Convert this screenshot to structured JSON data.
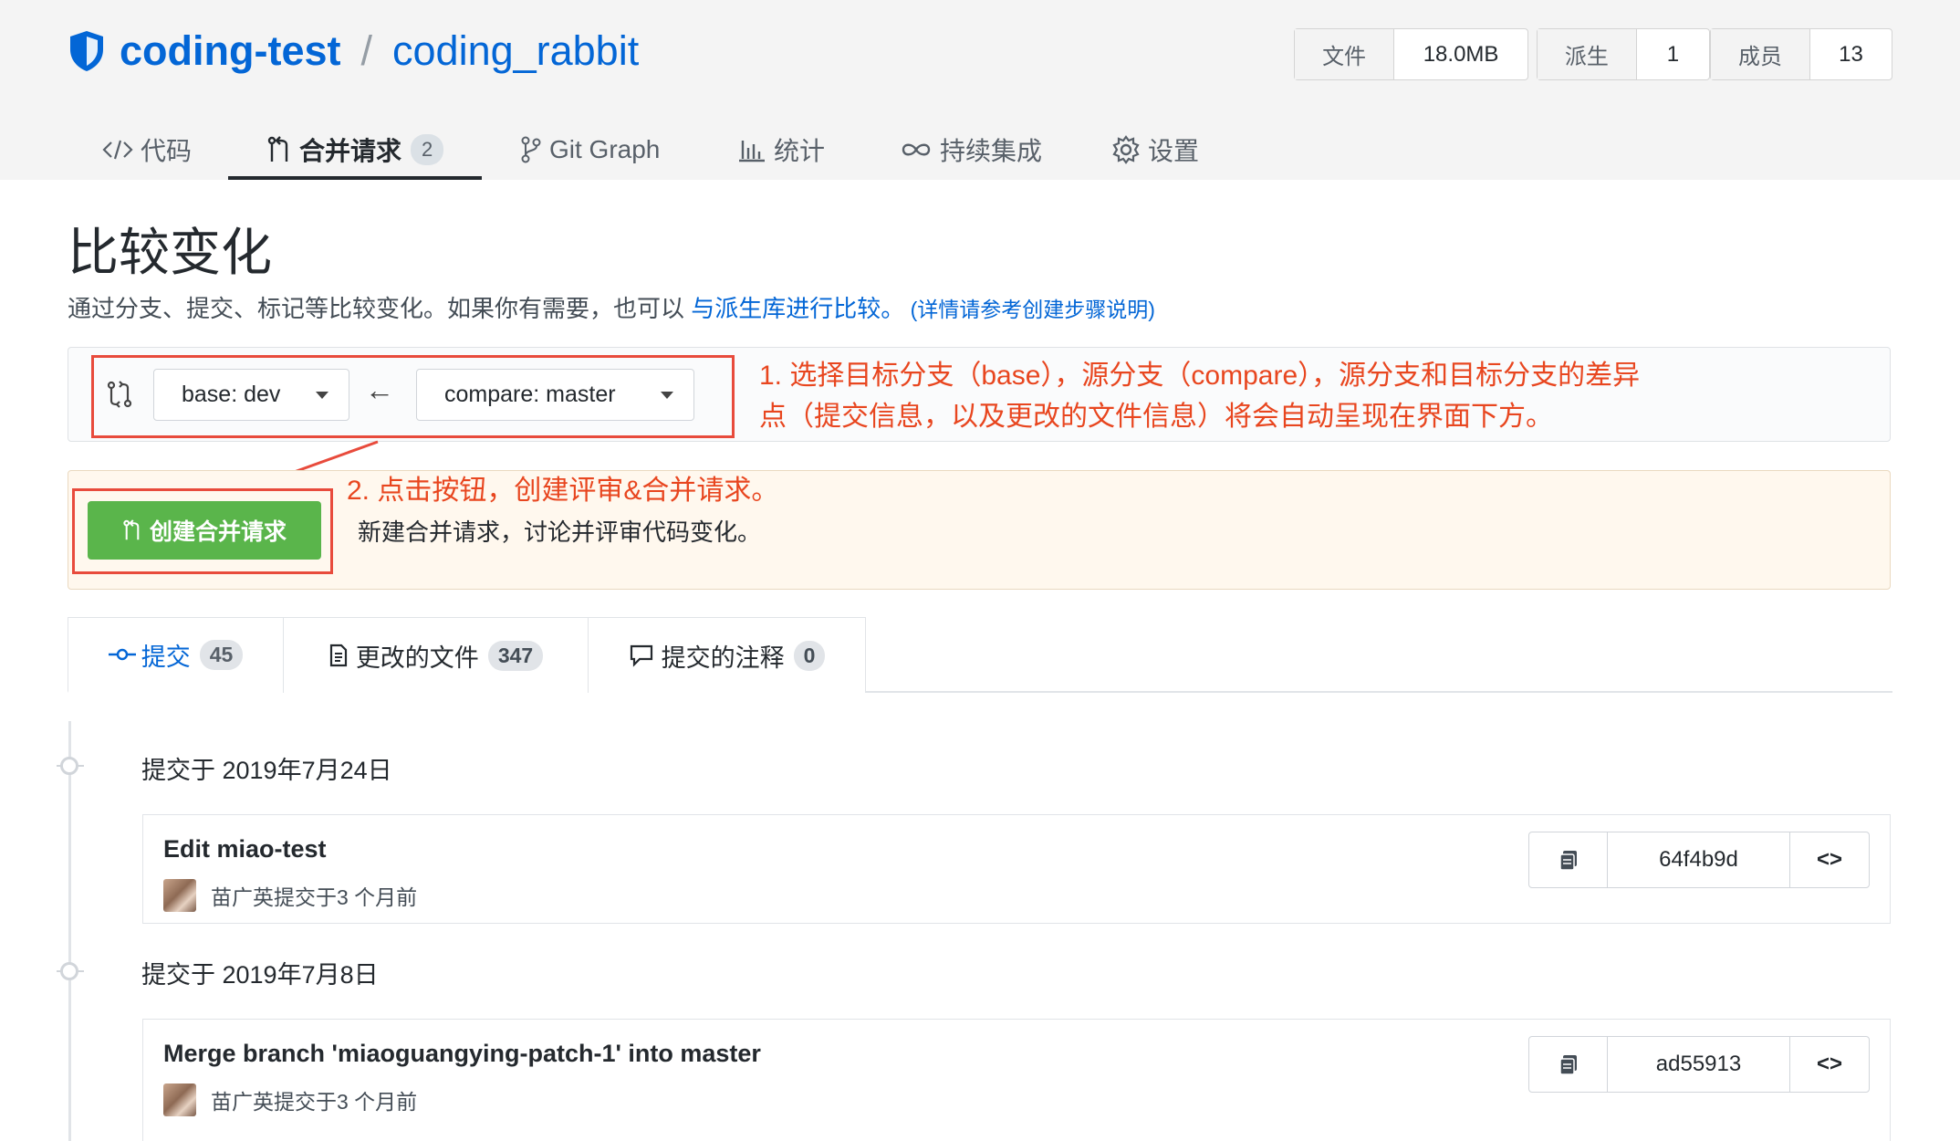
{
  "repo": {
    "owner": "coding-test",
    "separator": "/",
    "name": "coding_rabbit"
  },
  "stats": [
    {
      "label": "文件",
      "value": "18.0MB"
    },
    {
      "label": "派生",
      "value": "1"
    },
    {
      "label": "成员",
      "value": "13"
    }
  ],
  "tabs": [
    {
      "label": "代码",
      "icon": "code-icon"
    },
    {
      "label": "合并请求",
      "icon": "merge-request-icon",
      "badge": "2",
      "active": true
    },
    {
      "label": "Git Graph",
      "icon": "git-branch-icon"
    },
    {
      "label": "统计",
      "icon": "bar-chart-icon"
    },
    {
      "label": "持续集成",
      "icon": "infinity-icon"
    },
    {
      "label": "设置",
      "icon": "gear-icon"
    }
  ],
  "page": {
    "title": "比较变化",
    "desc_prefix": "通过分支、提交、标记等比较变化。如果你有需要，也可以 ",
    "desc_link": "与派生库进行比较。",
    "desc_link_small": " (详情请参考创建步骤说明)"
  },
  "compare": {
    "base_label": "base: dev",
    "compare_label": "compare: master",
    "arrow": "←"
  },
  "annotations": {
    "step1_line1": "1. 选择目标分支（base），源分支（compare），源分支和目标分支的差异",
    "step1_line2": "点（提交信息，以及更改的文件信息）将会自动呈现在界面下方。",
    "step2": "2. 点击按钮，创建评审&合并请求。"
  },
  "create": {
    "button_label": "创建合并请求",
    "description": "新建合并请求，讨论并评审代码变化。"
  },
  "sub_tabs": [
    {
      "label": "提交",
      "count": "45",
      "icon": "commit-icon",
      "active": true
    },
    {
      "label": "更改的文件",
      "count": "347",
      "icon": "file-diff-icon"
    },
    {
      "label": "提交的注释",
      "count": "0",
      "icon": "comment-icon"
    }
  ],
  "commit_groups": [
    {
      "date": "提交于 2019年7月24日",
      "commit": {
        "title": "Edit miao-test",
        "meta": "苗广英提交于3 个月前",
        "sha": "64f4b9d",
        "browse": "<>"
      }
    },
    {
      "date": "提交于 2019年7月8日",
      "commit": {
        "title": "Merge branch 'miaoguangying-patch-1' into master",
        "meta": "苗广英提交于3 个月前",
        "sha": "ad55913",
        "browse": "<>"
      }
    }
  ],
  "colors": {
    "link": "#0366d6",
    "annotation": "#e8461f",
    "create_button": "#5ab54b",
    "create_bar_bg": "#fff8ee"
  }
}
